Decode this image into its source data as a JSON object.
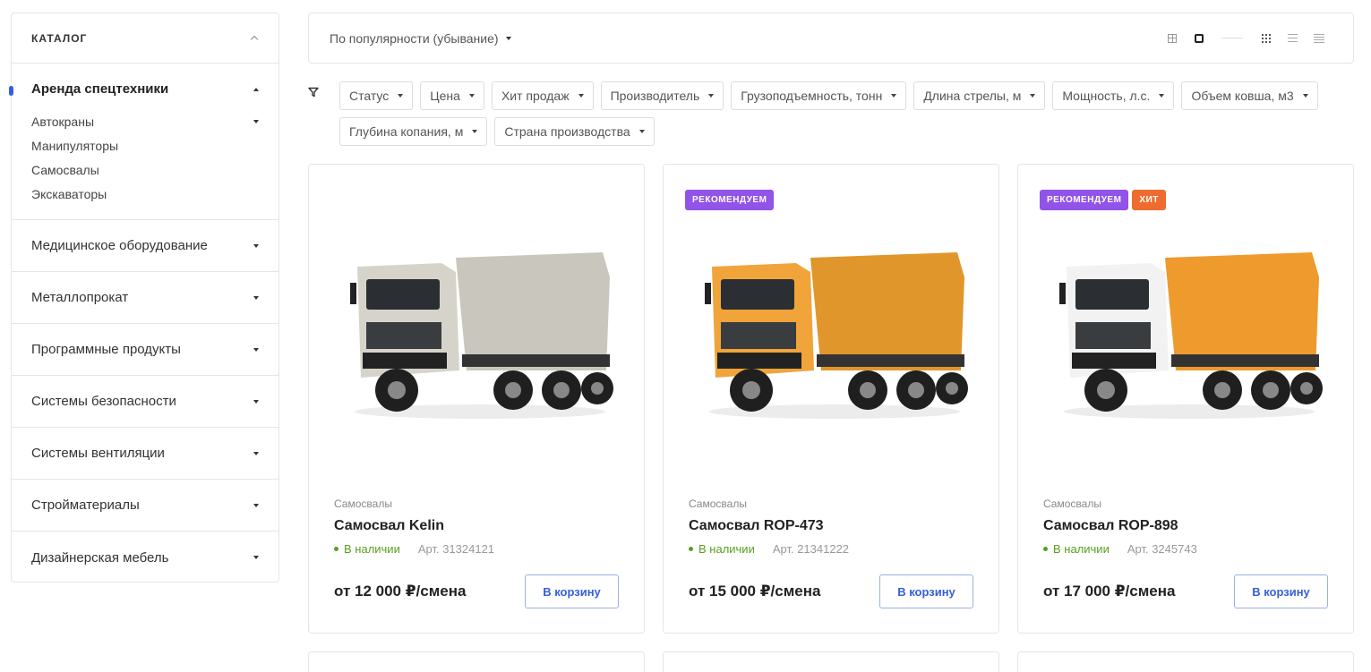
{
  "sidebar": {
    "title": "КАТАЛОГ",
    "active": {
      "title": "Аренда спецтехники",
      "sub": [
        "Автокраны",
        "Манипуляторы",
        "Самосвалы",
        "Экскаваторы"
      ]
    },
    "items": [
      "Медицинское оборудование",
      "Металлопрокат",
      "Программные продукты",
      "Системы безопасности",
      "Системы вентиляции",
      "Стройматериалы",
      "Дизайнерская мебель"
    ]
  },
  "sort": {
    "label": "По популярности (убывание)"
  },
  "filters": [
    "Статус",
    "Цена",
    "Хит продаж",
    "Производитель",
    "Грузоподъемность, тонн",
    "Длина стрелы, м",
    "Мощность, л.с.",
    "Объем ковша, м3",
    "Глубина копания, м",
    "Страна производства"
  ],
  "products": [
    {
      "badges": [],
      "category": "Самосвалы",
      "title": "Самосвал Kelin",
      "stock": "В наличии",
      "article": "Арт. 31324121",
      "price": "от 12 000 ₽/смена",
      "cart": "В корзину",
      "color": "#c9c7bd",
      "cab": "#d6d4ca"
    },
    {
      "badges": [
        "РЕКОМЕНДУЕМ"
      ],
      "category": "Самосвалы",
      "title": "Самосвал ROP-473",
      "stock": "В наличии",
      "article": "Арт. 21341222",
      "price": "от 15 000 ₽/смена",
      "cart": "В корзину",
      "color": "#e0962a",
      "cab": "#f0a43a"
    },
    {
      "badges": [
        "РЕКОМЕНДУЕМ",
        "ХИТ"
      ],
      "category": "Самосвалы",
      "title": "Самосвал ROP-898",
      "stock": "В наличии",
      "article": "Арт. 3245743",
      "price": "от 17 000 ₽/смена",
      "cart": "В корзину",
      "color": "#ee9a2c",
      "cab": "#f2f2f2"
    }
  ],
  "colors": {
    "accent": "#365edc",
    "badge_rec": "#9153e8",
    "badge_hit": "#ef6c30",
    "in_stock": "#5a9e1e"
  }
}
